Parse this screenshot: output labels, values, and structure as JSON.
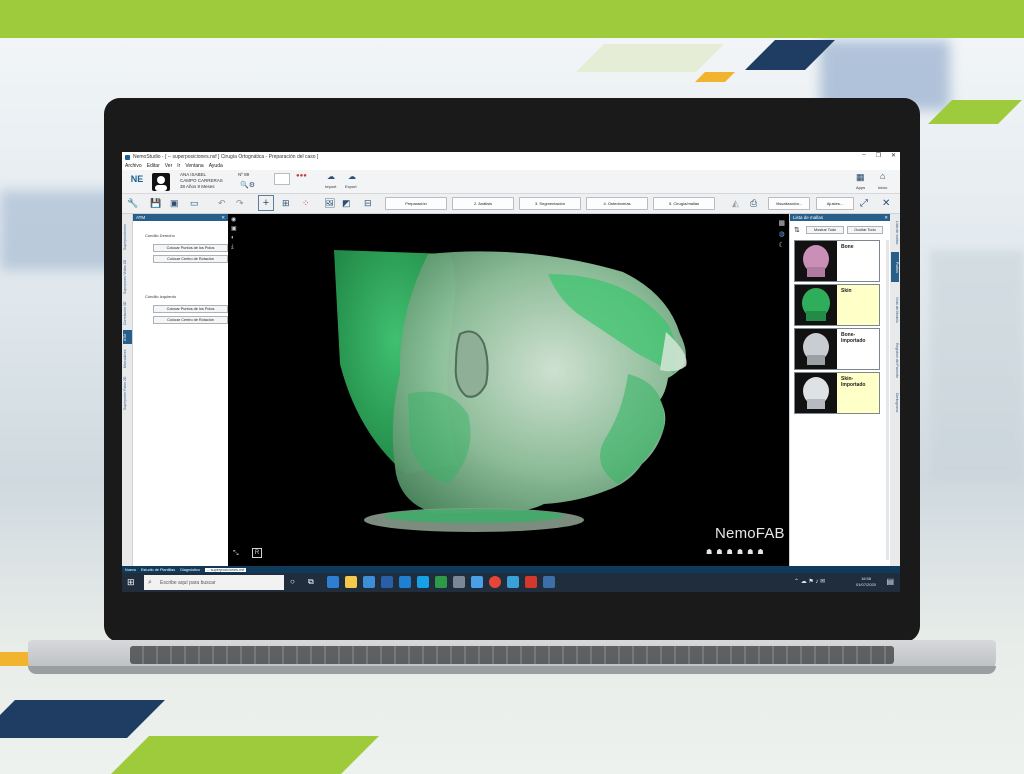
{
  "window": {
    "title": "NemoStudio - [ -- superposiciones.nsf ] Cirugía Ortognática - Preparación del caso ]",
    "controls": [
      "–",
      "❐",
      "✕"
    ]
  },
  "menu": [
    "Archivo",
    "Editar",
    "Ver",
    "Ir",
    "Ventana",
    "Ayuda"
  ],
  "patient": {
    "name": "ANA ISABEL",
    "surname": "CAMPO CARRERAS",
    "age_info": "38 Años 8 Meses",
    "record_number": "Nº 89",
    "import_label": "Import",
    "export_label": "Export",
    "inicio_label": "Inicio",
    "apps_label": "Apps"
  },
  "workflow_tabs": [
    {
      "label": "Preparación"
    },
    {
      "label": "2. Análisis"
    },
    {
      "label": "3. Segmentación"
    },
    {
      "label": "4. Osteotomías"
    },
    {
      "label": "5. Cirugía/mallas"
    },
    {
      "label": "Visualización..."
    },
    {
      "label": "Ajustes..."
    }
  ],
  "left_panel": {
    "title": "ATM",
    "right_condyle_label": "Cóndilo Derecho",
    "left_condyle_label": "Cóndilo Izquierdo",
    "buttons": [
      "Colocar Puntos de los Polos",
      "Colocar Centro de Rotación",
      "Colocar Puntos de los Polos",
      "Colocar Centro de Rotación"
    ],
    "vertical_tabs": [
      "Superposiciones",
      "Superponer Vistas 2D",
      "Correlación 3D",
      "ATM",
      "Marcadores",
      "Superponer Fotos 2D"
    ]
  },
  "viewport": {
    "brand_text": "NemoFAB",
    "reset_label": "R"
  },
  "mesh_panel": {
    "title": "Lista de mallas",
    "show_all": "Mostrar Todo",
    "hide_all": "Ocultar Todo",
    "meshes": [
      {
        "name": "Bone",
        "highlight": false
      },
      {
        "name": "Skin",
        "highlight": true
      },
      {
        "name": "Bone-Importado",
        "highlight": false
      },
      {
        "name": "Skin-Importado",
        "highlight": true
      }
    ],
    "vertical_tabs": [
      "Lista de mallas",
      "Puntos",
      "Vista del Modelo",
      "Registros del Paciente",
      "Dentograma"
    ]
  },
  "status_bar": [
    "Nuevo",
    "Estudio de Plantillas",
    "Diagnóstico",
    "-- superposiciones.nsf"
  ],
  "taskbar": {
    "search_placeholder": "Escribe aquí para buscar",
    "time": "16:58",
    "date": "01/07/2020"
  },
  "colors": {
    "brand_green": "#9ecb3c",
    "navy": "#1f3d63",
    "panel_header": "#275f8a",
    "mesh_highlight": "#ffffc8",
    "skin_mesh": "#2eae5b"
  }
}
